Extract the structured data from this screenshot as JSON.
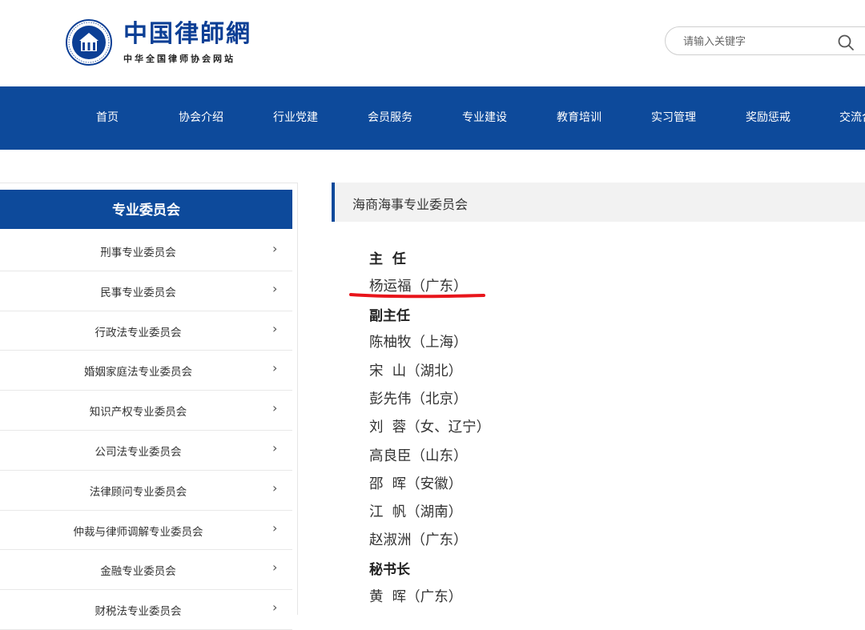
{
  "brand": {
    "title": "中国律師網",
    "subtitle": "中华全国律师协会网站"
  },
  "search": {
    "placeholder": "请输入关键字"
  },
  "nav": {
    "items": [
      "首页",
      "协会介绍",
      "行业党建",
      "会员服务",
      "专业建设",
      "教育培训",
      "实习管理",
      "奖励惩戒",
      "交流合"
    ]
  },
  "sidebar": {
    "title": "专业委员会",
    "items": [
      "刑事专业委员会",
      "民事专业委员会",
      "行政法专业委员会",
      "婚姻家庭法专业委员会",
      "知识产权专业委员会",
      "公司法专业委员会",
      "法律顾问专业委员会",
      "仲裁与律师调解专业委员会",
      "金融专业委员会",
      "财税法专业委员会"
    ]
  },
  "content": {
    "heading": "海商海事专业委员会",
    "director_title": "主  任",
    "director": "杨运福（广东）",
    "deputy_title": "副主任",
    "deputies": [
      "陈柚牧（上海）",
      "宋  山（湖北）",
      "彭先伟（北京）",
      "刘  蓉（女、辽宁）",
      "高良臣（山东）",
      "邵  晖（安徽）",
      "江  帆（湖南）",
      "赵淑洲（广东）"
    ],
    "secretary_title": "秘书长",
    "secretary": "黄  晖（广东）"
  },
  "colors": {
    "brand_blue": "#0d4a9b",
    "highlight_red": "#e8151b"
  }
}
